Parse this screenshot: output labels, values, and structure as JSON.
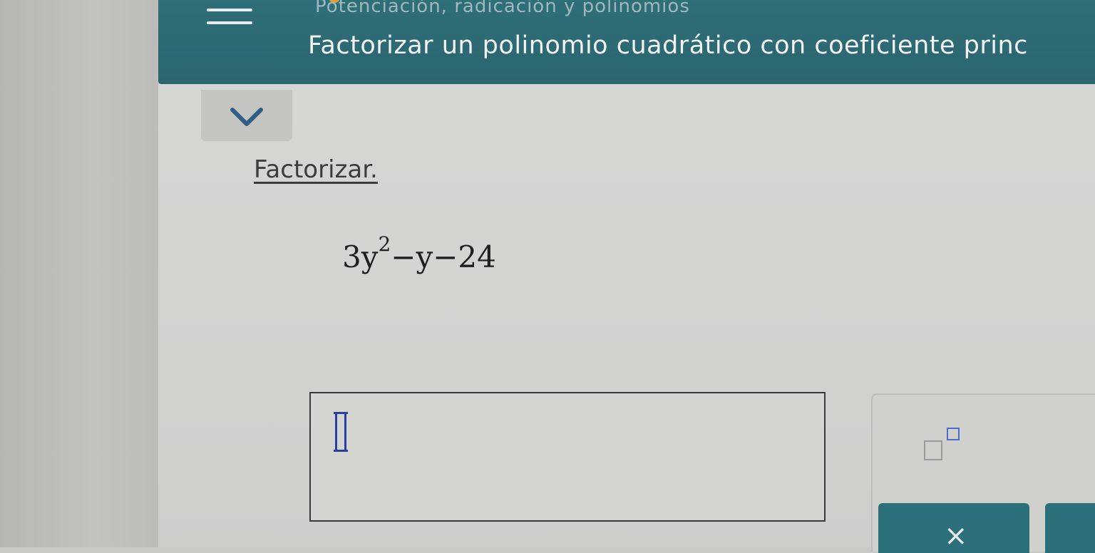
{
  "header": {
    "subtitle": "Potenciación, radicación y polinomios",
    "title": "Factorizar un polinomio cuadrático con coeficiente princ"
  },
  "icons": {
    "menu": "menu-icon",
    "collapse": "chevron-down-icon",
    "clear": "x-icon",
    "exponent": "exponent-template-icon"
  },
  "problem": {
    "instruction": "Factorizar.",
    "expression_base": "3y",
    "expression_exponent": "2",
    "expression_rest": "−y−24"
  },
  "answer": {
    "value": ""
  },
  "toolbar": {
    "clear_label": "×"
  },
  "colors": {
    "header": "#2f6f78",
    "button": "#2a6f7a",
    "cursor": "#2a3fa0"
  }
}
